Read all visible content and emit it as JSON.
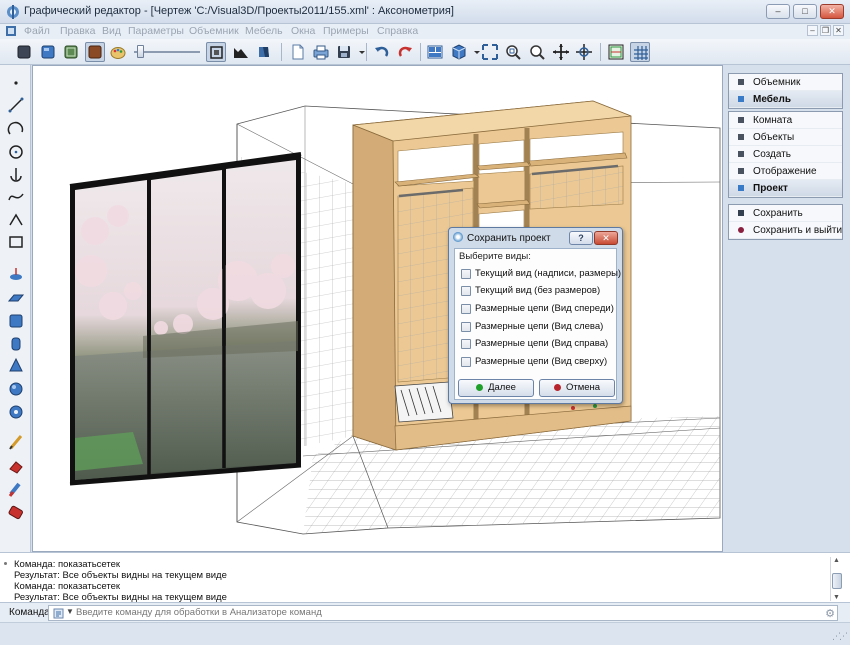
{
  "window": {
    "title": "Графический редактор - [Чертеж 'C:/Visual3D/Проекты2011/155.xml' : Аксонометрия]",
    "minimize": "–",
    "maximize": "□",
    "close": "✕"
  },
  "menu": {
    "items": [
      "Файл",
      "Правка",
      "Вид",
      "Параметры",
      "Объемник",
      "Мебель",
      "Окна",
      "Примеры",
      "Справка"
    ],
    "mdi_min": "–",
    "mdi_restore": "❐",
    "mdi_close": "✕"
  },
  "toolbar": {
    "icons": [
      "box-icon",
      "box-blue-icon",
      "box-green-icon",
      "box-brown-icon",
      "palette-icon",
      "brightness-slider",
      "render-square-icon",
      "histogram-icon",
      "shade-icon",
      "new-icon",
      "print-icon",
      "save-icon",
      "undo-icon",
      "redo-icon",
      "layout-icon",
      "view-cube-icon",
      "zoom-fit-icon",
      "zoom-window-icon",
      "zoom-icon",
      "pan-icon",
      "rotate-icon",
      "floorplan-icon",
      "grid-icon"
    ],
    "brightness": 0.05
  },
  "left_tools": [
    "point-icon",
    "line-icon",
    "arc-icon",
    "circle-icon",
    "anchor-icon",
    "spline-icon",
    "polyline-icon",
    "rectangle-icon",
    "extrude-icon",
    "plane-icon",
    "cube-icon",
    "cylinder-icon",
    "cone-icon",
    "sphere-icon",
    "torus-icon",
    "pencil-icon",
    "eraser-icon",
    "brush-icon",
    "paint-icon"
  ],
  "right_panel": {
    "group1": [
      {
        "label": "Объемник",
        "selected": false,
        "color": "#4a5260"
      },
      {
        "label": "Мебель",
        "selected": true,
        "color": "#3a7bc8"
      }
    ],
    "group2": [
      {
        "label": "Комната",
        "selected": false,
        "color": "#4a5260"
      },
      {
        "label": "Объекты",
        "selected": false,
        "color": "#4a5260"
      },
      {
        "label": "Создать",
        "selected": false,
        "color": "#4a5260"
      },
      {
        "label": "Отображение",
        "selected": false,
        "color": "#4a5260"
      },
      {
        "label": "Проект",
        "selected": true,
        "color": "#3a7bc8"
      }
    ],
    "group3": [
      {
        "label": "Сохранить",
        "selected": false,
        "color": "#34404f"
      },
      {
        "label": "Сохранить и выйти",
        "selected": false,
        "color": "#8a2040"
      }
    ]
  },
  "dialog": {
    "title": "Сохранить проект",
    "help": "?",
    "close": "✕",
    "prompt": "Выберите виды:",
    "options": [
      {
        "label": "Текущий вид (надписи, размеры)",
        "checked": false
      },
      {
        "label": "Текущий вид (без размеров)",
        "checked": false
      },
      {
        "label": "Размерные цепи (Вид спереди)",
        "checked": false
      },
      {
        "label": "Размерные цепи (Вид слева)",
        "checked": false
      },
      {
        "label": "Размерные цепи (Вид справа)",
        "checked": false
      },
      {
        "label": "Размерные цепи (Вид сверху)",
        "checked": false
      }
    ],
    "next_button": "Далее",
    "cancel_button": "Отмена",
    "next_color": "#1fa02a",
    "cancel_color": "#b8242c"
  },
  "log": {
    "lines": [
      "Команда: показатьсетек",
      "Результат: Все объекты видны на текущем виде",
      "Команда: показатьсетек",
      "Результат: Все объекты видны на текущем виде"
    ]
  },
  "command": {
    "label": "Команда:",
    "placeholder": "Введите команду для обработки в Анализаторе команд"
  },
  "colors": {
    "wood": "#ecc994",
    "wood_dark": "#d2ab76",
    "accent": "#3a7bc8"
  }
}
